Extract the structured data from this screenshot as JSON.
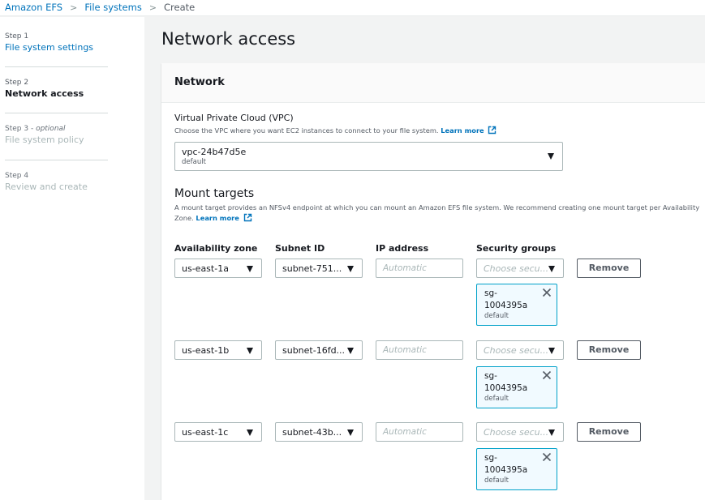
{
  "breadcrumbs": [
    "Amazon EFS",
    "File systems",
    "Create"
  ],
  "steps": [
    {
      "kicker": "Step 1",
      "optional": "",
      "title": "File system settings"
    },
    {
      "kicker": "Step 2",
      "optional": "",
      "title": "Network access"
    },
    {
      "kicker": "Step 3 - ",
      "optional": "optional",
      "title": "File system policy"
    },
    {
      "kicker": "Step 4",
      "optional": "",
      "title": "Review and create"
    }
  ],
  "page_title": "Network access",
  "network": {
    "title": "Network",
    "vpc": {
      "label": "Virtual Private Cloud (VPC)",
      "description": "Choose the VPC where you want EC2 instances to connect to your file system.",
      "learn_more": "Learn more",
      "value": "vpc-24b47d5e",
      "sub": "default"
    },
    "mount_targets": {
      "title": "Mount targets",
      "description": "A mount target provides an NFSv4 endpoint at which you can mount an Amazon EFS file system. We recommend creating one mount target per Availability Zone.",
      "learn_more": "Learn more",
      "headers": {
        "az": "Availability zone",
        "subnet": "Subnet ID",
        "ip": "IP address",
        "sg": "Security groups"
      },
      "rows": [
        {
          "az": "us-east-1a",
          "subnet": "subnet-751...",
          "ip_placeholder": "Automatic",
          "sg_placeholder": "Choose secu...",
          "remove": "Remove",
          "token_id": "sg-1004395a",
          "token_sub": "default"
        },
        {
          "az": "us-east-1b",
          "subnet": "subnet-16fd...",
          "ip_placeholder": "Automatic",
          "sg_placeholder": "Choose secu...",
          "remove": "Remove",
          "token_id": "sg-1004395a",
          "token_sub": "default"
        },
        {
          "az": "us-east-1c",
          "subnet": "subnet-43b...",
          "ip_placeholder": "Automatic",
          "sg_placeholder": "Choose secu...",
          "remove": "Remove",
          "token_id": "sg-1004395a",
          "token_sub": "default"
        }
      ]
    }
  },
  "icons": {
    "separator": "chevron-right-icon",
    "caret": "caret-down-icon",
    "external": "external-link-icon",
    "remove_token": "close-icon"
  },
  "colors": {
    "link": "#0073bb",
    "token_border": "#00a1c9",
    "token_bg": "#f1faff"
  }
}
